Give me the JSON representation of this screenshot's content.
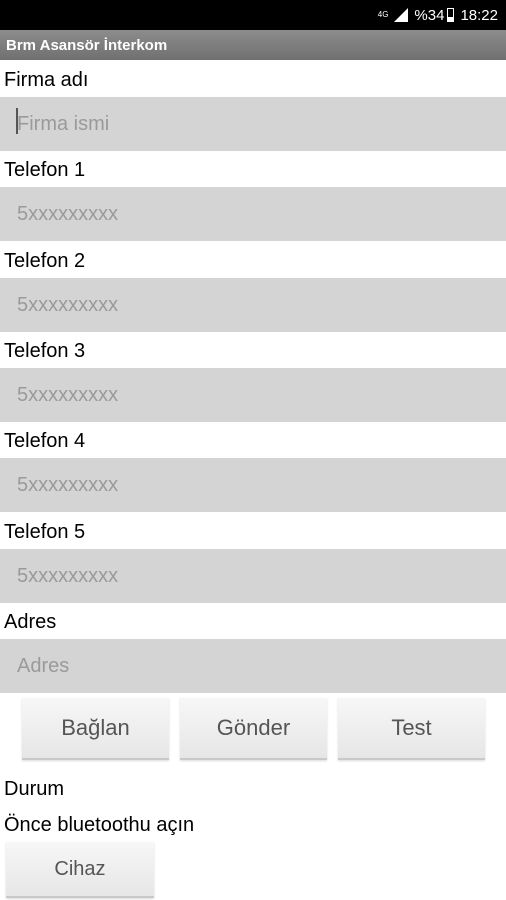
{
  "status_bar": {
    "network": "4G",
    "battery": "%34",
    "time": "18:22"
  },
  "app_bar": {
    "title": "Brm Asansör İnterkom"
  },
  "form": {
    "fields": [
      {
        "label": "Firma adı",
        "placeholder": "Firma ismi",
        "value": ""
      },
      {
        "label": "Telefon 1",
        "placeholder": "5xxxxxxxxx",
        "value": ""
      },
      {
        "label": "Telefon 2",
        "placeholder": "5xxxxxxxxx",
        "value": ""
      },
      {
        "label": "Telefon 3",
        "placeholder": "5xxxxxxxxx",
        "value": ""
      },
      {
        "label": "Telefon 4",
        "placeholder": "5xxxxxxxxx",
        "value": ""
      },
      {
        "label": "Telefon 5",
        "placeholder": "5xxxxxxxxx",
        "value": ""
      },
      {
        "label": "Adres",
        "placeholder": "Adres",
        "value": ""
      }
    ]
  },
  "actions": {
    "connect_label": "Bağlan",
    "send_label": "Gönder",
    "test_label": "Test"
  },
  "status": {
    "heading": "Durum",
    "message": "Önce bluetoothu açın"
  },
  "device_button_label": "Cihaz"
}
